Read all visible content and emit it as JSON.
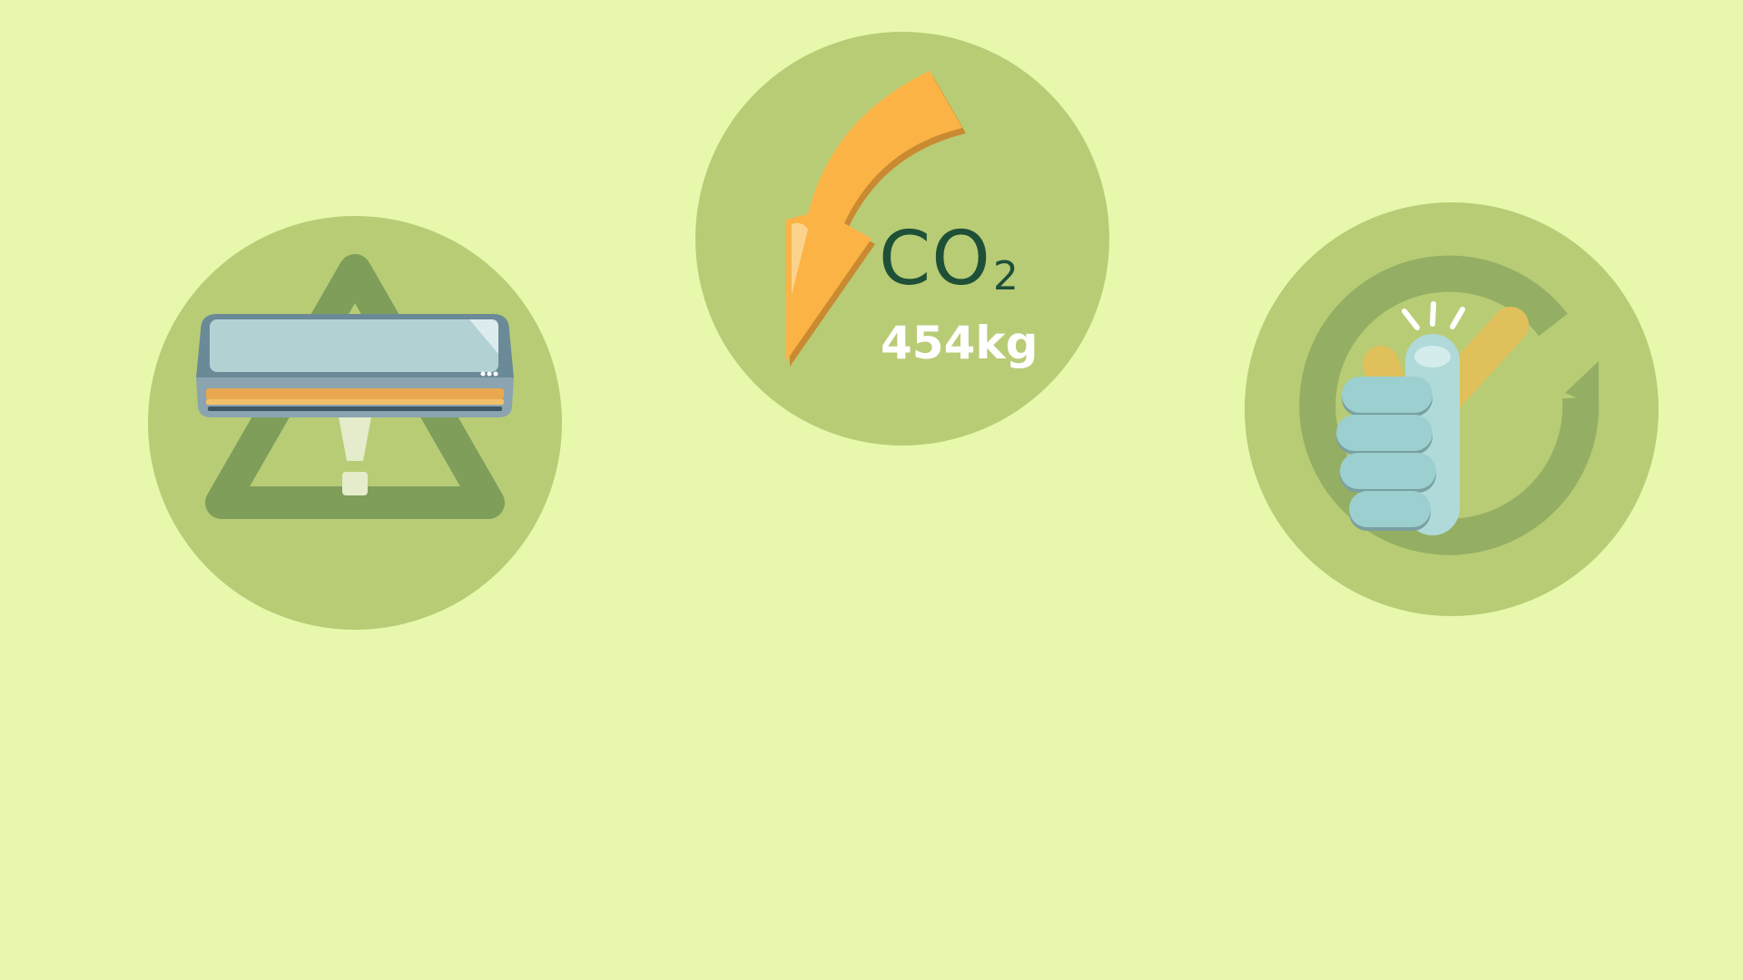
{
  "colors": {
    "background": "#e7f8ad",
    "circle": "#b8cc76",
    "triangle": "#7e9e5a",
    "arrow": "#fbb345",
    "co2_text": "#1e5038",
    "check": "#dfc05a",
    "hand": "#a8d6d6"
  },
  "badges": {
    "ac_warning": {
      "icons": [
        "air-conditioner-icon",
        "warning-triangle-icon"
      ]
    },
    "co2": {
      "icon": "down-arrow-icon",
      "label": "CO",
      "subscript": "2",
      "amount": "454kg"
    },
    "approval": {
      "icons": [
        "thumbs-up-icon",
        "check-mark-icon"
      ]
    }
  }
}
